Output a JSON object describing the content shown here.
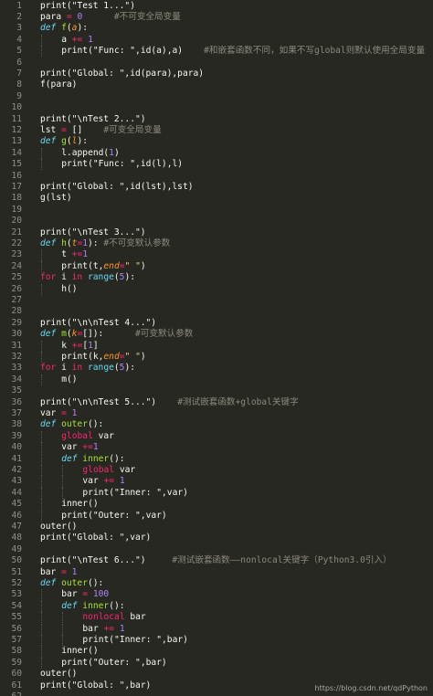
{
  "editor": {
    "lines": [
      {
        "n": "1",
        "indent": 0,
        "tokens": [
          [
            "plain",
            "print(\"Test 1...\")"
          ]
        ]
      },
      {
        "n": "2",
        "indent": 0,
        "tokens": [
          [
            "plain",
            "para "
          ],
          [
            "op",
            "="
          ],
          [
            "plain",
            " "
          ],
          [
            "num",
            "0"
          ],
          [
            "plain",
            "      "
          ],
          [
            "cmt",
            "#不可变全局变量"
          ]
        ]
      },
      {
        "n": "3",
        "indent": 0,
        "tokens": [
          [
            "kw",
            "def"
          ],
          [
            "plain",
            " "
          ],
          [
            "fn",
            "f"
          ],
          [
            "plain",
            "("
          ],
          [
            "param",
            "a"
          ],
          [
            "plain",
            "):"
          ]
        ]
      },
      {
        "n": "4",
        "indent": 1,
        "tokens": [
          [
            "plain",
            "a "
          ],
          [
            "op",
            "+="
          ],
          [
            "plain",
            " "
          ],
          [
            "num",
            "1"
          ]
        ]
      },
      {
        "n": "5",
        "indent": 1,
        "tokens": [
          [
            "plain",
            "print(\"Func: \",id(a),a)    "
          ],
          [
            "cmt",
            "#和嵌套函数不同，如果不写global则默认使用全局变量"
          ]
        ]
      },
      {
        "n": "6",
        "indent": 0,
        "tokens": []
      },
      {
        "n": "7",
        "indent": 0,
        "tokens": [
          [
            "plain",
            "print(\"Global: \",id(para),para)"
          ]
        ]
      },
      {
        "n": "8",
        "indent": 0,
        "tokens": [
          [
            "plain",
            "f(para)"
          ]
        ]
      },
      {
        "n": "9",
        "indent": 0,
        "tokens": []
      },
      {
        "n": "10",
        "indent": 0,
        "tokens": []
      },
      {
        "n": "11",
        "indent": 0,
        "tokens": [
          [
            "plain",
            "print(\"\\nTest 2...\")"
          ]
        ]
      },
      {
        "n": "12",
        "indent": 0,
        "tokens": [
          [
            "plain",
            "lst "
          ],
          [
            "op",
            "="
          ],
          [
            "plain",
            " []    "
          ],
          [
            "cmt",
            "#可变全局变量"
          ]
        ]
      },
      {
        "n": "13",
        "indent": 0,
        "tokens": [
          [
            "kw",
            "def"
          ],
          [
            "plain",
            " "
          ],
          [
            "fn",
            "g"
          ],
          [
            "plain",
            "("
          ],
          [
            "param",
            "l"
          ],
          [
            "plain",
            "):"
          ]
        ]
      },
      {
        "n": "14",
        "indent": 1,
        "tokens": [
          [
            "plain",
            "l.append("
          ],
          [
            "num",
            "1"
          ],
          [
            "plain",
            ")"
          ]
        ]
      },
      {
        "n": "15",
        "indent": 1,
        "tokens": [
          [
            "plain",
            "print(\"Func: \",id(l),l)"
          ]
        ]
      },
      {
        "n": "16",
        "indent": 0,
        "tokens": []
      },
      {
        "n": "17",
        "indent": 0,
        "tokens": [
          [
            "plain",
            "print(\"Global: \",id(lst),lst)"
          ]
        ]
      },
      {
        "n": "18",
        "indent": 0,
        "tokens": [
          [
            "plain",
            "g(lst)"
          ]
        ]
      },
      {
        "n": "19",
        "indent": 0,
        "tokens": []
      },
      {
        "n": "20",
        "indent": 0,
        "tokens": []
      },
      {
        "n": "21",
        "indent": 0,
        "tokens": [
          [
            "plain",
            "print(\"\\nTest 3...\")"
          ]
        ]
      },
      {
        "n": "22",
        "indent": 0,
        "tokens": [
          [
            "kw",
            "def"
          ],
          [
            "plain",
            " "
          ],
          [
            "fn",
            "h"
          ],
          [
            "plain",
            "("
          ],
          [
            "param",
            "t"
          ],
          [
            "op",
            "="
          ],
          [
            "num",
            "1"
          ],
          [
            "plain",
            "): "
          ],
          [
            "cmt",
            "#不可变默认参数"
          ]
        ]
      },
      {
        "n": "23",
        "indent": 1,
        "tokens": [
          [
            "plain",
            "t "
          ],
          [
            "op",
            "+="
          ],
          [
            "num",
            "1"
          ]
        ]
      },
      {
        "n": "24",
        "indent": 1,
        "tokens": [
          [
            "plain",
            "print(t,"
          ],
          [
            "param",
            "end"
          ],
          [
            "op",
            "="
          ],
          [
            "str",
            "\" \""
          ],
          [
            "plain",
            ")"
          ]
        ]
      },
      {
        "n": "25",
        "indent": 0,
        "tokens": [
          [
            "ctl",
            "for"
          ],
          [
            "plain",
            " i "
          ],
          [
            "ctl",
            "in"
          ],
          [
            "plain",
            " "
          ],
          [
            "bi",
            "range"
          ],
          [
            "plain",
            "("
          ],
          [
            "num",
            "5"
          ],
          [
            "plain",
            "):"
          ]
        ]
      },
      {
        "n": "26",
        "indent": 1,
        "tokens": [
          [
            "plain",
            "h()"
          ]
        ]
      },
      {
        "n": "27",
        "indent": 0,
        "tokens": []
      },
      {
        "n": "28",
        "indent": 0,
        "tokens": []
      },
      {
        "n": "29",
        "indent": 0,
        "tokens": [
          [
            "plain",
            "print(\"\\n\\nTest 4...\")"
          ]
        ]
      },
      {
        "n": "30",
        "indent": 0,
        "tokens": [
          [
            "kw",
            "def"
          ],
          [
            "plain",
            " "
          ],
          [
            "fn",
            "m"
          ],
          [
            "plain",
            "("
          ],
          [
            "param",
            "k"
          ],
          [
            "op",
            "="
          ],
          [
            "plain",
            "[]):      "
          ],
          [
            "cmt",
            "#可变默认参数"
          ]
        ]
      },
      {
        "n": "31",
        "indent": 1,
        "tokens": [
          [
            "plain",
            "k "
          ],
          [
            "op",
            "+="
          ],
          [
            "plain",
            "["
          ],
          [
            "num",
            "1"
          ],
          [
            "plain",
            "]"
          ]
        ]
      },
      {
        "n": "32",
        "indent": 1,
        "tokens": [
          [
            "plain",
            "print(k,"
          ],
          [
            "param",
            "end"
          ],
          [
            "op",
            "="
          ],
          [
            "str",
            "\" \""
          ],
          [
            "plain",
            ")"
          ]
        ]
      },
      {
        "n": "33",
        "indent": 0,
        "tokens": [
          [
            "ctl",
            "for"
          ],
          [
            "plain",
            " i "
          ],
          [
            "ctl",
            "in"
          ],
          [
            "plain",
            " "
          ],
          [
            "bi",
            "range"
          ],
          [
            "plain",
            "("
          ],
          [
            "num",
            "5"
          ],
          [
            "plain",
            "):"
          ]
        ]
      },
      {
        "n": "34",
        "indent": 1,
        "tokens": [
          [
            "plain",
            "m()"
          ]
        ]
      },
      {
        "n": "35",
        "indent": 0,
        "tokens": []
      },
      {
        "n": "36",
        "indent": 0,
        "tokens": [
          [
            "plain",
            "print(\"\\n\\nTest 5...\")    "
          ],
          [
            "cmt",
            "#测试嵌套函数+global关键字"
          ]
        ]
      },
      {
        "n": "37",
        "indent": 0,
        "tokens": [
          [
            "plain",
            "var "
          ],
          [
            "op",
            "="
          ],
          [
            "plain",
            " "
          ],
          [
            "num",
            "1"
          ]
        ]
      },
      {
        "n": "38",
        "indent": 0,
        "tokens": [
          [
            "kw",
            "def"
          ],
          [
            "plain",
            " "
          ],
          [
            "fn",
            "outer"
          ],
          [
            "plain",
            "():"
          ]
        ]
      },
      {
        "n": "39",
        "indent": 1,
        "tokens": [
          [
            "ctl",
            "global"
          ],
          [
            "plain",
            " var"
          ]
        ]
      },
      {
        "n": "40",
        "indent": 1,
        "tokens": [
          [
            "plain",
            "var "
          ],
          [
            "op",
            "+="
          ],
          [
            "num",
            "1"
          ]
        ]
      },
      {
        "n": "41",
        "indent": 1,
        "tokens": [
          [
            "kw",
            "def"
          ],
          [
            "plain",
            " "
          ],
          [
            "fn",
            "inner"
          ],
          [
            "plain",
            "():"
          ]
        ]
      },
      {
        "n": "42",
        "indent": 2,
        "tokens": [
          [
            "ctl",
            "global"
          ],
          [
            "plain",
            " var"
          ]
        ]
      },
      {
        "n": "43",
        "indent": 2,
        "tokens": [
          [
            "plain",
            "var "
          ],
          [
            "op",
            "+="
          ],
          [
            "plain",
            " "
          ],
          [
            "num",
            "1"
          ]
        ]
      },
      {
        "n": "44",
        "indent": 2,
        "tokens": [
          [
            "plain",
            "print(\"Inner: \",var)"
          ]
        ]
      },
      {
        "n": "45",
        "indent": 1,
        "tokens": [
          [
            "plain",
            "inner()"
          ]
        ]
      },
      {
        "n": "46",
        "indent": 1,
        "tokens": [
          [
            "plain",
            "print(\"Outer: \",var)"
          ]
        ]
      },
      {
        "n": "47",
        "indent": 0,
        "tokens": [
          [
            "plain",
            "outer()"
          ]
        ]
      },
      {
        "n": "48",
        "indent": 0,
        "tokens": [
          [
            "plain",
            "print(\"Global: \",var)"
          ]
        ]
      },
      {
        "n": "49",
        "indent": 0,
        "tokens": []
      },
      {
        "n": "50",
        "indent": 0,
        "tokens": [
          [
            "plain",
            "print(\"\\nTest 6...\")     "
          ],
          [
            "cmt",
            "#测试嵌套函数——nonlocal关键字（Python3.0引入）"
          ]
        ]
      },
      {
        "n": "51",
        "indent": 0,
        "tokens": [
          [
            "plain",
            "bar "
          ],
          [
            "op",
            "="
          ],
          [
            "plain",
            " "
          ],
          [
            "num",
            "1"
          ]
        ]
      },
      {
        "n": "52",
        "indent": 0,
        "tokens": [
          [
            "kw",
            "def"
          ],
          [
            "plain",
            " "
          ],
          [
            "fn",
            "outer"
          ],
          [
            "plain",
            "():"
          ]
        ]
      },
      {
        "n": "53",
        "indent": 1,
        "tokens": [
          [
            "plain",
            "bar "
          ],
          [
            "op",
            "="
          ],
          [
            "plain",
            " "
          ],
          [
            "num",
            "100"
          ]
        ]
      },
      {
        "n": "54",
        "indent": 1,
        "tokens": [
          [
            "kw",
            "def"
          ],
          [
            "plain",
            " "
          ],
          [
            "fn",
            "inner"
          ],
          [
            "plain",
            "():"
          ]
        ]
      },
      {
        "n": "55",
        "indent": 2,
        "tokens": [
          [
            "ctl",
            "nonlocal"
          ],
          [
            "plain",
            " bar"
          ]
        ]
      },
      {
        "n": "56",
        "indent": 2,
        "tokens": [
          [
            "plain",
            "bar "
          ],
          [
            "op",
            "+="
          ],
          [
            "plain",
            " "
          ],
          [
            "num",
            "1"
          ]
        ]
      },
      {
        "n": "57",
        "indent": 2,
        "tokens": [
          [
            "plain",
            "print(\"Inner: \",bar)"
          ]
        ]
      },
      {
        "n": "58",
        "indent": 1,
        "tokens": [
          [
            "plain",
            "inner()"
          ]
        ]
      },
      {
        "n": "59",
        "indent": 1,
        "tokens": [
          [
            "plain",
            "print(\"Outer: \",bar)"
          ]
        ]
      },
      {
        "n": "60",
        "indent": 0,
        "tokens": [
          [
            "plain",
            "outer()"
          ]
        ]
      },
      {
        "n": "61",
        "indent": 0,
        "tokens": [
          [
            "plain",
            "print(\"Global: \",bar)"
          ]
        ]
      },
      {
        "n": "62",
        "indent": 0,
        "tokens": []
      }
    ]
  },
  "watermark": "https://blog.csdn.net/qdPython",
  "colors": {
    "background": "#272822",
    "line_number": "#8f908a",
    "plain": "#f8f8f2",
    "keyword": "#66d9ef",
    "control": "#f92672",
    "number": "#ae81ff",
    "string": "#e6db74",
    "comment": "#8c8a7d",
    "function": "#a6e22e",
    "parameter": "#fd971f"
  }
}
